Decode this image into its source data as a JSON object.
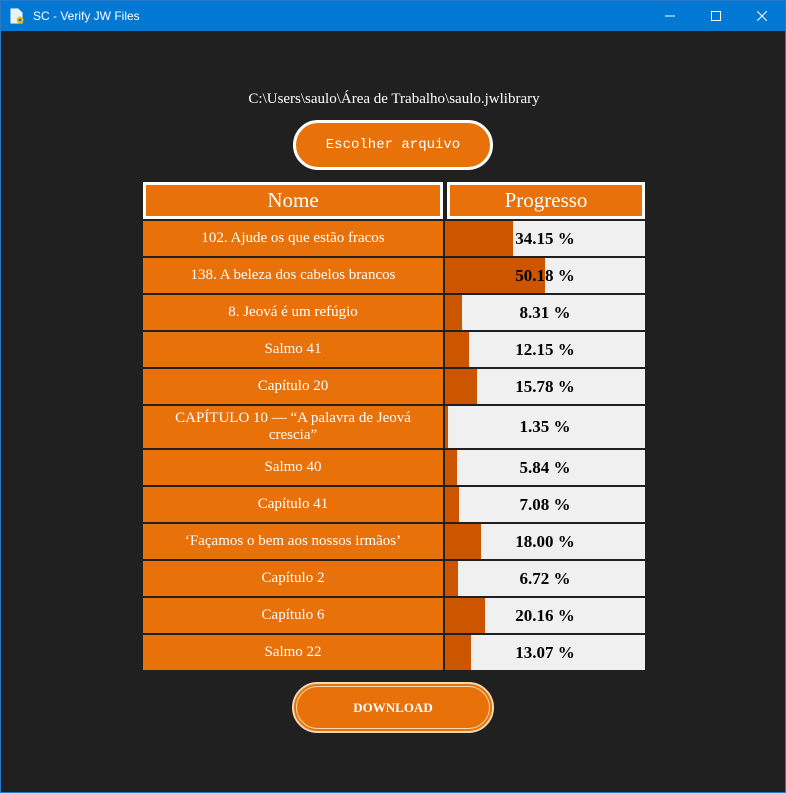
{
  "window": {
    "title": "SC - Verify JW Files",
    "icon": "document-gear-icon",
    "controls": [
      "minimize-icon",
      "maximize-icon",
      "close-icon"
    ]
  },
  "file_path": "C:\\Users\\saulo\\Área de Trabalho\\saulo.jwlibrary",
  "choose_button": "Escolher arquivo",
  "table": {
    "headers": {
      "name": "Nome",
      "progress": "Progresso"
    },
    "rows": [
      {
        "name": "102. Ajude os que estão fracos",
        "progress_text": "34.15 %",
        "progress": 34.15
      },
      {
        "name": "138. A beleza dos cabelos brancos",
        "progress_text": "50.18 %",
        "progress": 50.18
      },
      {
        "name": "8. Jeová é um refúgio",
        "progress_text": "8.31 %",
        "progress": 8.31
      },
      {
        "name": "Salmo 41",
        "progress_text": "12.15 %",
        "progress": 12.15
      },
      {
        "name": "Capítulo 20",
        "progress_text": "15.78 %",
        "progress": 15.78
      },
      {
        "name": "CAPÍTULO 10 — “A palavra de Jeová crescia”",
        "progress_text": "1.35 %",
        "progress": 1.35
      },
      {
        "name": "Salmo 40",
        "progress_text": "5.84 %",
        "progress": 5.84
      },
      {
        "name": "Capítulo 41",
        "progress_text": "7.08 %",
        "progress": 7.08
      },
      {
        "name": "‘Façamos o bem aos nossos irmãos’",
        "progress_text": "18.00 %",
        "progress": 18.0
      },
      {
        "name": "Capítulo 2",
        "progress_text": "6.72 %",
        "progress": 6.72
      },
      {
        "name": "Capítulo 6",
        "progress_text": "20.16 %",
        "progress": 20.16
      },
      {
        "name": "Salmo 22",
        "progress_text": "13.07 %",
        "progress": 13.07
      }
    ]
  },
  "download_button": "DOWNLOAD",
  "colors": {
    "accent": "#e8710a",
    "bar_fill": "#cc5500",
    "bar_track": "#f0f0f0",
    "background": "#202020",
    "titlebar": "#0078d4"
  }
}
